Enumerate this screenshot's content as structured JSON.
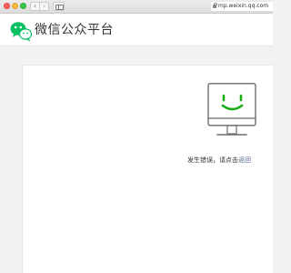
{
  "browser": {
    "url": "mp.weixin.qq.com",
    "nav_back": "‹",
    "nav_forward": "›"
  },
  "header": {
    "brand": "微信公众平台",
    "logo_icon": "wechat-logo-icon",
    "brand_color": "#07c160"
  },
  "error": {
    "message_prefix": "发生错误，请点击",
    "link_text": "返回",
    "icon": "smiling-monitor-icon",
    "face_color": "#1aad19"
  }
}
